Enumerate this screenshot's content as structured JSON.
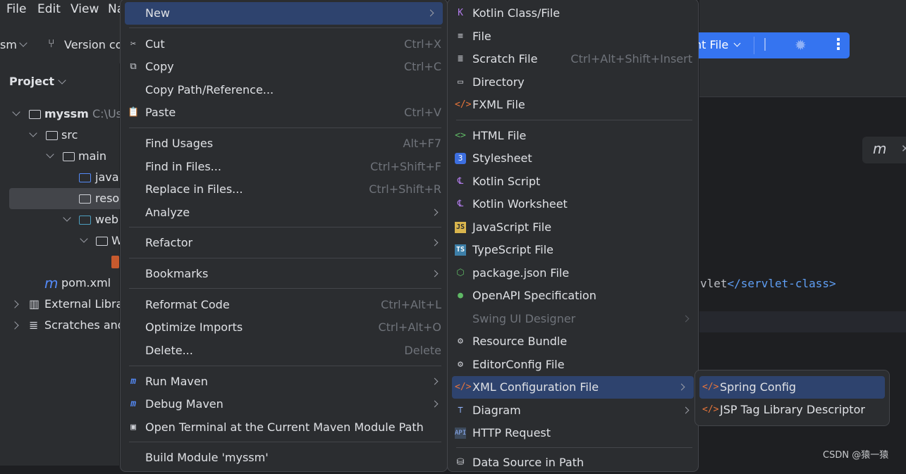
{
  "menubar": {
    "items": [
      "File",
      "Edit",
      "View",
      "Na"
    ]
  },
  "toolbar": {
    "project_selector": "sm",
    "vcs_label": "Version co"
  },
  "run_widget": {
    "label": "nt File"
  },
  "project_panel": {
    "title": "Project",
    "tree": [
      {
        "label": "myssm",
        "extra": "C:\\Us"
      },
      {
        "label": "src"
      },
      {
        "label": "main"
      },
      {
        "label": "java"
      },
      {
        "label": "reso"
      },
      {
        "label": "web"
      },
      {
        "label": "W"
      },
      {
        "label": "pom.xml"
      },
      {
        "label": "External Libra"
      },
      {
        "label": "Scratches and"
      }
    ]
  },
  "editor": {
    "code_line_text": "vlet",
    "code_line_tag": "</servlet-class>",
    "watermark": "CSDN @猿一猿"
  },
  "context_menu": {
    "items": [
      {
        "label": "New",
        "shortcut": ""
      },
      {
        "label": "Cut",
        "shortcut": "Ctrl+X"
      },
      {
        "label": "Copy",
        "shortcut": "Ctrl+C"
      },
      {
        "label": "Copy Path/Reference...",
        "shortcut": ""
      },
      {
        "label": "Paste",
        "shortcut": "Ctrl+V"
      },
      {
        "label": "Find Usages",
        "shortcut": "Alt+F7"
      },
      {
        "label": "Find in Files...",
        "shortcut": "Ctrl+Shift+F"
      },
      {
        "label": "Replace in Files...",
        "shortcut": "Ctrl+Shift+R"
      },
      {
        "label": "Analyze",
        "shortcut": ""
      },
      {
        "label": "Refactor",
        "shortcut": ""
      },
      {
        "label": "Bookmarks",
        "shortcut": ""
      },
      {
        "label": "Reformat Code",
        "shortcut": "Ctrl+Alt+L"
      },
      {
        "label": "Optimize Imports",
        "shortcut": "Ctrl+Alt+O"
      },
      {
        "label": "Delete...",
        "shortcut": "Delete"
      },
      {
        "label": "Run Maven",
        "shortcut": ""
      },
      {
        "label": "Debug Maven",
        "shortcut": ""
      },
      {
        "label": "Open Terminal at the Current Maven Module Path",
        "shortcut": ""
      },
      {
        "label": "Build Module 'myssm'",
        "shortcut": ""
      }
    ]
  },
  "new_submenu": {
    "items": [
      {
        "label": "Kotlin Class/File",
        "shortcut": ""
      },
      {
        "label": "File",
        "shortcut": ""
      },
      {
        "label": "Scratch File",
        "shortcut": "Ctrl+Alt+Shift+Insert"
      },
      {
        "label": "Directory",
        "shortcut": ""
      },
      {
        "label": "FXML File",
        "shortcut": ""
      },
      {
        "label": "HTML File",
        "shortcut": ""
      },
      {
        "label": "Stylesheet",
        "shortcut": ""
      },
      {
        "label": "Kotlin Script",
        "shortcut": ""
      },
      {
        "label": "Kotlin Worksheet",
        "shortcut": ""
      },
      {
        "label": "JavaScript File",
        "shortcut": ""
      },
      {
        "label": "TypeScript File",
        "shortcut": ""
      },
      {
        "label": "package.json File",
        "shortcut": ""
      },
      {
        "label": "OpenAPI Specification",
        "shortcut": ""
      },
      {
        "label": "Swing UI Designer",
        "shortcut": ""
      },
      {
        "label": "Resource Bundle",
        "shortcut": ""
      },
      {
        "label": "EditorConfig File",
        "shortcut": ""
      },
      {
        "label": "XML Configuration File",
        "shortcut": ""
      },
      {
        "label": "Diagram",
        "shortcut": ""
      },
      {
        "label": "HTTP Request",
        "shortcut": ""
      },
      {
        "label": "Data Source in Path",
        "shortcut": ""
      }
    ]
  },
  "xml_submenu": {
    "items": [
      {
        "label": "Spring Config"
      },
      {
        "label": "JSP Tag Library Descriptor"
      }
    ]
  },
  "colors": {
    "accent": "#3574f0",
    "highlight": "#2e436e",
    "menu_bg": "#2b2d30"
  }
}
